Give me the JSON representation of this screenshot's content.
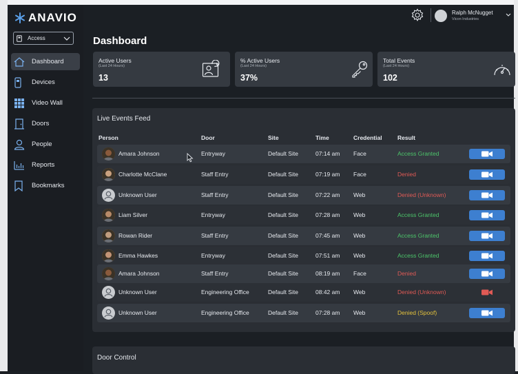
{
  "app": {
    "logo_text": "ANAVIO",
    "accent": "#3d7fd0"
  },
  "sidebar": {
    "access_select": {
      "value": "Access"
    },
    "items": [
      {
        "label": "Dashboard",
        "icon": "home-icon",
        "active": true
      },
      {
        "label": "Devices",
        "icon": "device-icon"
      },
      {
        "label": "Video Wall",
        "icon": "grid-icon"
      },
      {
        "label": "Doors",
        "icon": "door-icon"
      },
      {
        "label": "People",
        "icon": "person-icon"
      },
      {
        "label": "Reports",
        "icon": "chart-icon"
      },
      {
        "label": "Bookmarks",
        "icon": "bookmark-icon"
      }
    ]
  },
  "user": {
    "name": "Ralph McNugget",
    "org": "Vicon Industries"
  },
  "page": {
    "title": "Dashboard"
  },
  "stats": [
    {
      "title": "Active Users",
      "sub": "(Last 24 Hours)",
      "value": "13",
      "icon": "user-refresh-icon"
    },
    {
      "title": "% Active Users",
      "sub": "(Last 24 Hours)",
      "value": "37%",
      "icon": "key-icon"
    },
    {
      "title": "Total Events",
      "sub": "(Last 24 Hours)",
      "value": "102",
      "icon": "gauge-icon"
    }
  ],
  "feed": {
    "title": "Live Events Feed",
    "columns": [
      "Person",
      "Door",
      "Site",
      "Time",
      "Credential",
      "Result"
    ],
    "rows": [
      {
        "person": "Amara Johnson",
        "door": "Entryway",
        "site": "Default Site",
        "time": "07:14 am",
        "credential": "Face",
        "result": "Access Granted",
        "result_color": "#4cc46a",
        "known": true
      },
      {
        "person": "Charlotte McClane",
        "door": "Staff Entry",
        "site": "Default Site",
        "time": "07:19 am",
        "credential": "Face",
        "result": "Denied",
        "result_color": "#e05a55",
        "known": true
      },
      {
        "person": "Unknown User",
        "door": "Staff Entry",
        "site": "Default Site",
        "time": "07:22 am",
        "credential": "Web",
        "result": "Denied (Unknown)",
        "result_color": "#e05a55",
        "known": false
      },
      {
        "person": "Liam Silver",
        "door": "Entryway",
        "site": "Default Site",
        "time": "07:28 am",
        "credential": "Web",
        "result": "Access Granted",
        "result_color": "#4cc46a",
        "known": true
      },
      {
        "person": "Rowan Rider",
        "door": "Staff Entry",
        "site": "Default Site",
        "time": "07:45 am",
        "credential": "Web",
        "result": "Access Granted",
        "result_color": "#4cc46a",
        "known": true
      },
      {
        "person": "Emma Hawkes",
        "door": "Entryway",
        "site": "Default Site",
        "time": "07:51 am",
        "credential": "Web",
        "result": "Access Granted",
        "result_color": "#4cc46a",
        "known": true
      },
      {
        "person": "Amara Johnson",
        "door": "Staff Entry",
        "site": "Default Site",
        "time": "08:19 am",
        "credential": "Face",
        "result": "Denied",
        "result_color": "#e05a55",
        "known": true
      },
      {
        "person": "Unknown User",
        "door": "Engineering Office",
        "site": "Default Site",
        "time": "08:42 am",
        "credential": "Web",
        "result": "Denied (Unknown)",
        "result_color": "#e05a55",
        "known": false,
        "camera_style": "bare-red"
      },
      {
        "person": "Unknown User",
        "door": "Engineering Office",
        "site": "Default Site",
        "time": "07:28 am",
        "credential": "Web",
        "result": "Denied (Spoof)",
        "result_color": "#e4c23c",
        "known": false
      }
    ]
  },
  "door_control": {
    "title": "Door Control"
  }
}
